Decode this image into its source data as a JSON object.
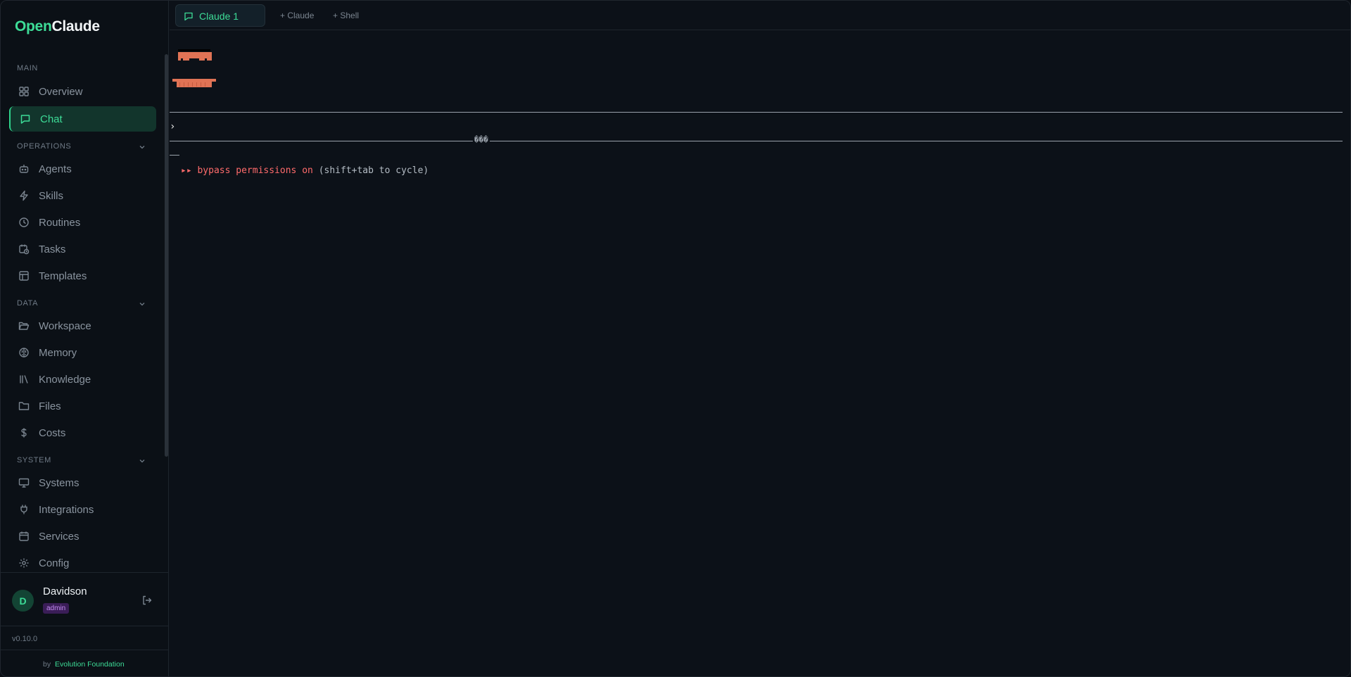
{
  "brand": {
    "part1": "Open",
    "part2": "Claude"
  },
  "sidebar": {
    "sections": [
      {
        "title": "MAIN",
        "items": [
          {
            "label": "Overview",
            "icon": "grid-icon"
          },
          {
            "label": "Chat",
            "icon": "message-icon",
            "active": true
          }
        ]
      },
      {
        "title": "OPERATIONS",
        "items": [
          {
            "label": "Agents",
            "icon": "bot-icon"
          },
          {
            "label": "Skills",
            "icon": "bolt-icon"
          },
          {
            "label": "Routines",
            "icon": "clock-icon"
          },
          {
            "label": "Tasks",
            "icon": "calendar-clock-icon"
          },
          {
            "label": "Templates",
            "icon": "layout-icon"
          }
        ]
      },
      {
        "title": "DATA",
        "items": [
          {
            "label": "Workspace",
            "icon": "folder-open-icon"
          },
          {
            "label": "Memory",
            "icon": "brain-icon"
          },
          {
            "label": "Knowledge",
            "icon": "library-icon"
          },
          {
            "label": "Files",
            "icon": "folder-icon"
          },
          {
            "label": "Costs",
            "icon": "dollar-icon"
          }
        ]
      },
      {
        "title": "SYSTEM",
        "items": [
          {
            "label": "Systems",
            "icon": "monitor-icon"
          },
          {
            "label": "Integrations",
            "icon": "plug-icon"
          },
          {
            "label": "Services",
            "icon": "calendar-icon"
          },
          {
            "label": "Config",
            "icon": "gear-icon"
          }
        ]
      }
    ],
    "user": {
      "initial": "D",
      "name": "Davidson",
      "role": "admin"
    },
    "version": "v0.10.0",
    "credit": {
      "by": "by",
      "org": "Evolution Foundation"
    }
  },
  "tabs": {
    "active": "Claude 1",
    "add_claude": "+ Claude",
    "add_shell": "+ Shell"
  },
  "terminal": {
    "prompt": "›",
    "glyphs": "���",
    "status_arrows": "▸▸",
    "status_main": "bypass permissions on",
    "status_hint": "(shift+tab to cycle)"
  },
  "colors": {
    "accent": "#3ddc97",
    "active_bg": "#12352c",
    "logo_orange": "#e07355",
    "status_red": "#ff6b6b",
    "badge_purple": "#c38bf0"
  }
}
